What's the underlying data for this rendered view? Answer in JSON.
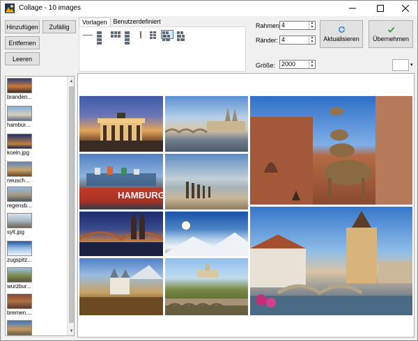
{
  "window": {
    "title": "Collage - 10 images"
  },
  "left_buttons": {
    "add": "Hinzufügen",
    "random": "Zufällig",
    "remove": "Entfernen",
    "clear": "Leeren"
  },
  "tabs": [
    {
      "label": "Vorlagen",
      "active": true
    },
    {
      "label": "Benutzerdefiniert",
      "active": false
    }
  ],
  "settings": {
    "frame_label": "Rahmen:",
    "frame_value": "4",
    "margin_label": "Ränder:",
    "margin_value": "4",
    "size_label": "Größe:",
    "size_value": "2000"
  },
  "actions": {
    "update": "Aktualisieren",
    "apply": "Übernehmen"
  },
  "image_list": [
    {
      "label": "branden..."
    },
    {
      "label": "hambur..."
    },
    {
      "label": "koeln.jpg"
    },
    {
      "label": "neusch..."
    },
    {
      "label": "regensb..."
    },
    {
      "label": "sylt.jpg"
    },
    {
      "label": "zugspitz..."
    },
    {
      "label": "wurzbur..."
    },
    {
      "label": "bremen...."
    }
  ],
  "colors": {
    "accent": "#3b7bd6",
    "check_green": "#2f9e3b",
    "refresh_blue": "#2d7fd3"
  }
}
